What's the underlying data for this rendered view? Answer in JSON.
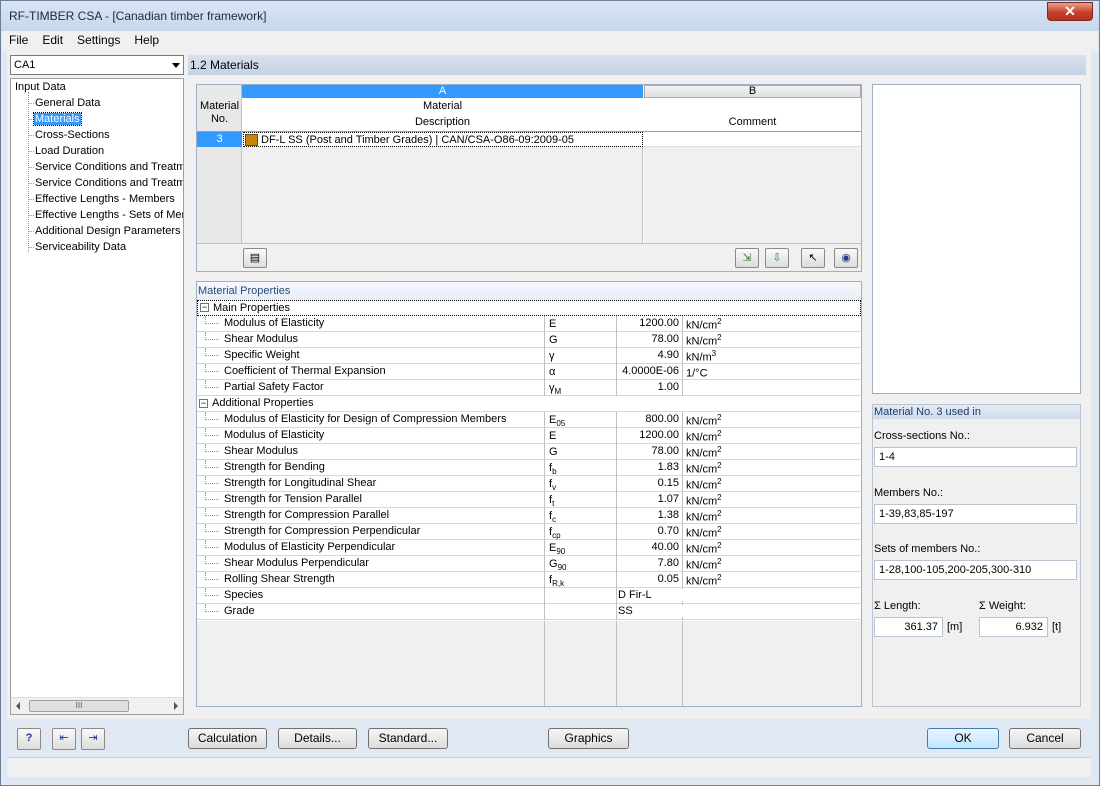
{
  "window": {
    "title": "RF-TIMBER CSA - [Canadian timber framework]",
    "close": "✕"
  },
  "menu": [
    "File",
    "Edit",
    "Settings",
    "Help"
  ],
  "case_select": "CA1",
  "tree": {
    "root": "Input Data",
    "items": [
      "General Data",
      "Materials",
      "Cross-Sections",
      "Load Duration",
      "Service Conditions and Treatme",
      "Service Conditions and Treatme",
      "Effective Lengths - Members",
      "Effective Lengths - Sets of Mer",
      "Additional Design Parameters",
      "Serviceability Data"
    ],
    "selected": "Materials"
  },
  "section_title": "1.2 Materials",
  "material_table": {
    "col_a": "A",
    "col_b": "B",
    "header_no": [
      "Material",
      "No."
    ],
    "header_desc": [
      "Material",
      "Description"
    ],
    "header_comment": "Comment",
    "row": {
      "no": "3",
      "description": "DF-L SS (Post and Timber Grades) | CAN/CSA-O86-09:2009-05",
      "comment": ""
    }
  },
  "properties": {
    "title": "Material Properties",
    "main_group": "Main Properties",
    "main": [
      {
        "name": "Modulus of Elasticity",
        "sym": "E",
        "sub": "",
        "val": "1200.00",
        "unit": "kN/cm",
        "sup": "2"
      },
      {
        "name": "Shear Modulus",
        "sym": "G",
        "sub": "",
        "val": "78.00",
        "unit": "kN/cm",
        "sup": "2"
      },
      {
        "name": "Specific Weight",
        "sym": "γ",
        "sub": "",
        "val": "4.90",
        "unit": "kN/m",
        "sup": "3"
      },
      {
        "name": "Coefficient of Thermal Expansion",
        "sym": "α",
        "sub": "",
        "val": "4.0000E-06",
        "unit": "1/°C",
        "sup": ""
      },
      {
        "name": "Partial Safety Factor",
        "sym": "γ",
        "sub": "M",
        "val": "1.00",
        "unit": "",
        "sup": ""
      }
    ],
    "add_group": "Additional Properties",
    "additional": [
      {
        "name": "Modulus of Elasticity for Design of Compression Members",
        "sym": "E",
        "sub": "05",
        "val": "800.00",
        "unit": "kN/cm",
        "sup": "2"
      },
      {
        "name": "Modulus of Elasticity",
        "sym": "E",
        "sub": "",
        "val": "1200.00",
        "unit": "kN/cm",
        "sup": "2"
      },
      {
        "name": "Shear Modulus",
        "sym": "G",
        "sub": "",
        "val": "78.00",
        "unit": "kN/cm",
        "sup": "2"
      },
      {
        "name": "Strength for Bending",
        "sym": "f",
        "sub": "b",
        "val": "1.83",
        "unit": "kN/cm",
        "sup": "2"
      },
      {
        "name": "Strength for Longitudinal Shear",
        "sym": "f",
        "sub": "v",
        "val": "0.15",
        "unit": "kN/cm",
        "sup": "2"
      },
      {
        "name": "Strength for Tension Parallel",
        "sym": "f",
        "sub": "t",
        "val": "1.07",
        "unit": "kN/cm",
        "sup": "2"
      },
      {
        "name": "Strength for Compression Parallel",
        "sym": "f",
        "sub": "c",
        "val": "1.38",
        "unit": "kN/cm",
        "sup": "2"
      },
      {
        "name": "Strength for Compression Perpendicular",
        "sym": "f",
        "sub": "cp",
        "val": "0.70",
        "unit": "kN/cm",
        "sup": "2"
      },
      {
        "name": "Modulus of Elasticity Perpendicular",
        "sym": "E",
        "sub": "90",
        "val": "40.00",
        "unit": "kN/cm",
        "sup": "2"
      },
      {
        "name": "Shear Modulus Perpendicular",
        "sym": "G",
        "sub": "90",
        "val": "7.80",
        "unit": "kN/cm",
        "sup": "2"
      },
      {
        "name": "Rolling Shear Strength",
        "sym": "f",
        "sub": "R,k",
        "val": "0.05",
        "unit": "kN/cm",
        "sup": "2"
      },
      {
        "name": "Species",
        "sym": "",
        "sub": "",
        "val": "D Fir-L",
        "unit": "",
        "sup": ""
      },
      {
        "name": "Grade",
        "sym": "",
        "sub": "",
        "val": "SS",
        "unit": "",
        "sup": ""
      }
    ]
  },
  "usage": {
    "title": "Material No. 3 used in",
    "cross_sections_label": "Cross-sections No.:",
    "cross_sections": "1-4",
    "members_label": "Members No.:",
    "members": "1-39,83,85-197",
    "sets_label": "Sets of members No.:",
    "sets": "1-28,100-105,200-205,300-310",
    "length_label": "Σ Length:",
    "length": "361.37",
    "length_unit": "[m]",
    "weight_label": "Σ Weight:",
    "weight": "6.932",
    "weight_unit": "[t]"
  },
  "buttons": {
    "calculation": "Calculation",
    "details": "Details...",
    "standard": "Standard...",
    "graphics": "Graphics",
    "ok": "OK",
    "cancel": "Cancel"
  },
  "colors": {
    "selection": "#3399ff",
    "header_blue": "#3399ff",
    "material_swatch": "#c8860b"
  }
}
